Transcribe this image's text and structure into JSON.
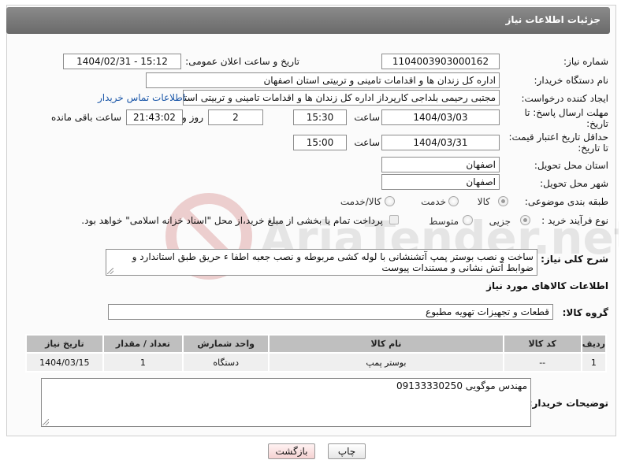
{
  "header": {
    "title": "جزئیات اطلاعات نیاز"
  },
  "fields": {
    "need_number_label": "شماره نیاز:",
    "need_number": "1104003903000162",
    "announce_label": "تاریخ و ساعت اعلان عمومی:",
    "announce_value": "1404/02/31 - 15:12",
    "buyer_org_label": "نام دستگاه خریدار:",
    "buyer_org": "اداره کل زندان ها و اقدامات تامینی و تربیتی استان اصفهان",
    "requester_label": "ایجاد کننده درخواست:",
    "requester": "مجتبی رحیمی بلداجی کارپرداز اداره کل زندان ها و اقدامات تامینی و تربیتی استان اصفهان",
    "contact_link": "اطلاعات تماس خریدار",
    "deadline_label": "مهلت ارسال پاسخ: تا تاریخ:",
    "deadline_date": "1404/03/03",
    "time_label": "ساعت",
    "deadline_time": "15:30",
    "days_value": "2",
    "days_label": "روز و",
    "remaining_time": "21:43:02",
    "remaining_label": "ساعت باقی مانده",
    "price_validity_label": "حداقل تاریخ اعتبار قیمت: تا تاریخ:",
    "price_validity_date": "1404/03/31",
    "price_validity_time": "15:00",
    "province_label": "استان محل تحویل:",
    "province": "اصفهان",
    "city_label": "شهر محل تحویل:",
    "city": "اصفهان"
  },
  "category": {
    "label": "طبقه بندی موضوعی:",
    "options": [
      "کالا",
      "خدمت",
      "کالا/خدمت"
    ],
    "selected": "کالا"
  },
  "process": {
    "label": "نوع فرآیند خرید :",
    "options": [
      "جزیی",
      "متوسط"
    ],
    "selected": "جزیی",
    "payment_note": "پرداخت تمام یا بخشی از مبلغ خرید،از محل \"اسناد خزانه اسلامی\" خواهد بود."
  },
  "description": {
    "label": "شرح کلی نیاز:",
    "text": "ساخت و نصب بوستر پمپ آتشنشانی با لوله کشی مربوطه و نصب جعبه اطفا ء حریق طبق استاندارد و ضوابط آتش نشانی و مستندات پیوست"
  },
  "goods_info": {
    "title": "اطلاعات کالاهای مورد نیاز",
    "group_label": "گروه کالا:",
    "group_value": "قطعات و تجهیزات تهویه مطبوع"
  },
  "table": {
    "headers": [
      "ردیف",
      "کد کالا",
      "نام کالا",
      "واحد شمارش",
      "تعداد / مقدار",
      "تاریخ نیاز"
    ],
    "rows": [
      [
        "1",
        "--",
        "بوستر پمپ",
        "دستگاه",
        "1",
        "1404/03/15"
      ]
    ]
  },
  "buyer_notes": {
    "label": "توضیحات خریدار:",
    "text": "مهندس موگویی 09133330250"
  },
  "buttons": {
    "print": "چاپ",
    "back": "بازگشت"
  },
  "watermark": {
    "text": "AriaTender.net"
  }
}
